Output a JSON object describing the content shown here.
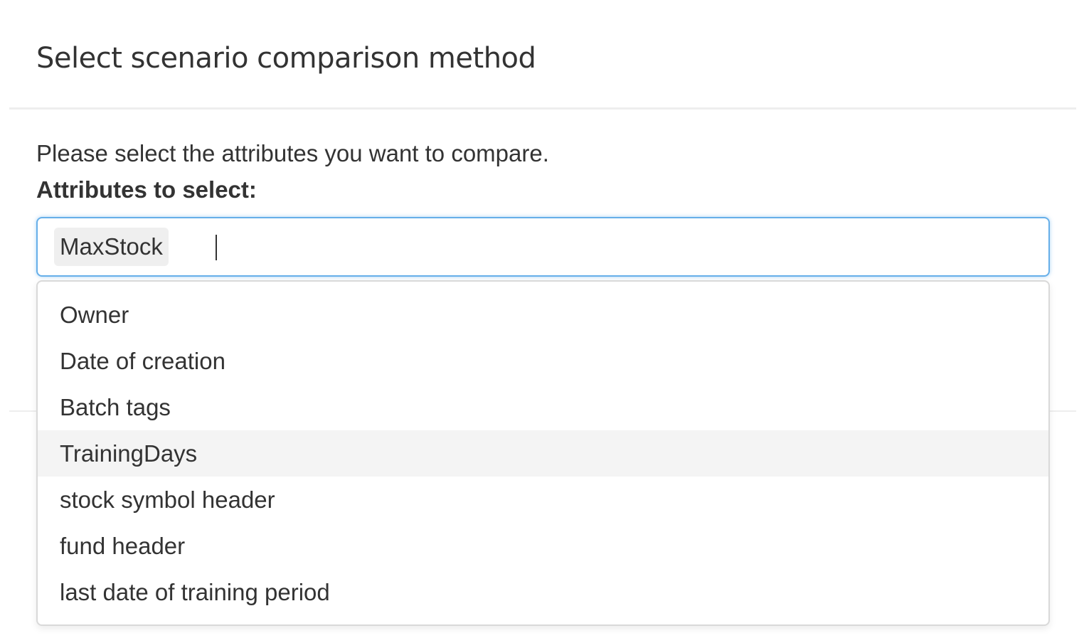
{
  "modal": {
    "title": "Select scenario comparison method"
  },
  "body": {
    "instruction": "Please select the attributes you want to compare.",
    "label": "Attributes to select:"
  },
  "select": {
    "selected": [
      "MaxStock"
    ],
    "search_value": "",
    "options": [
      "Owner",
      "Date of creation",
      "Batch tags",
      "TrainingDays",
      "stock symbol header",
      "fund header",
      "last date of training period"
    ],
    "highlighted_option": "TrainingDays"
  },
  "colors": {
    "focus_border": "#66afe9",
    "chip_background": "#efefef",
    "highlight_background": "#f4f4f4",
    "text": "#333333"
  }
}
